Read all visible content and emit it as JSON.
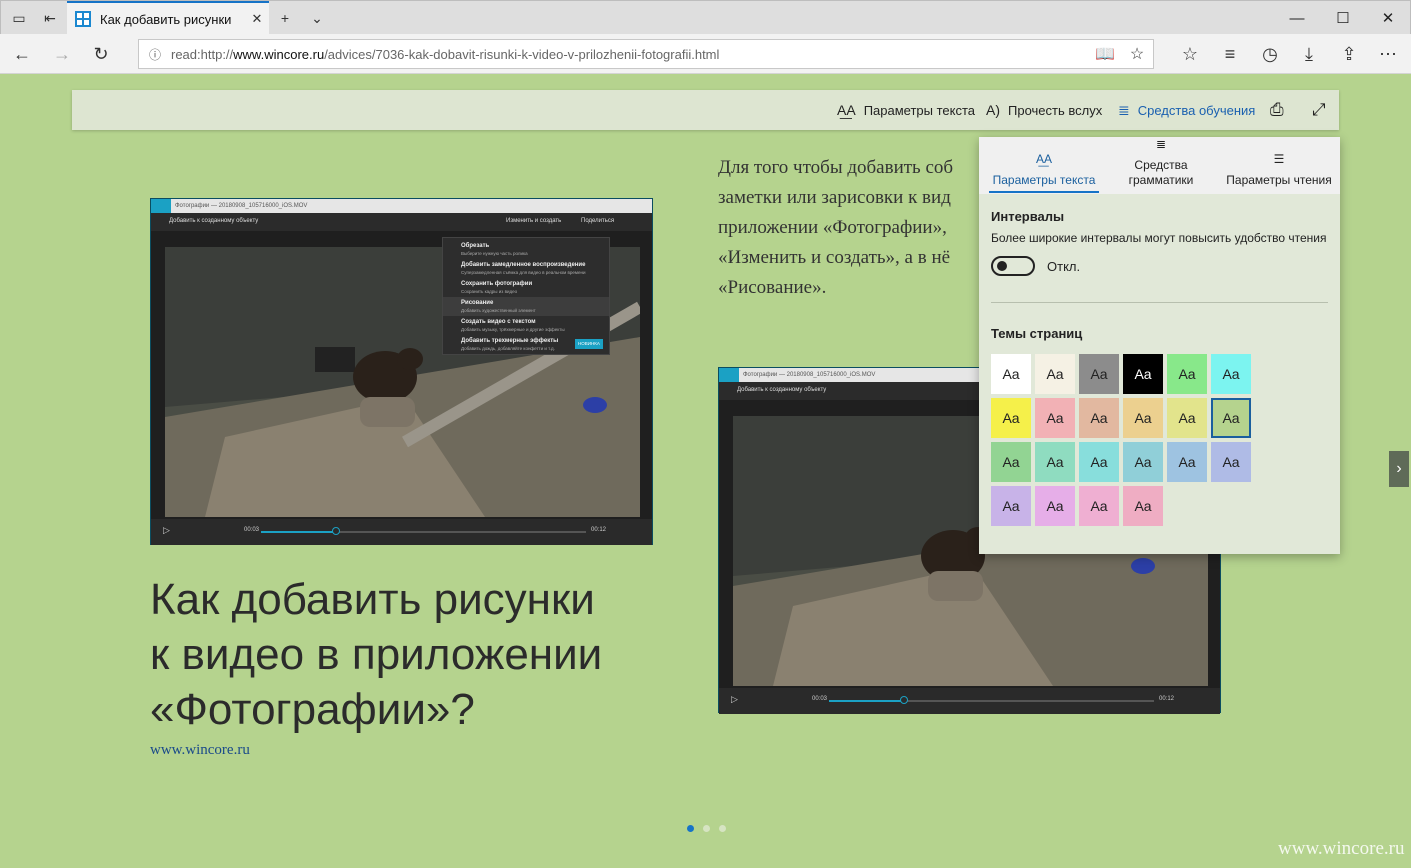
{
  "browser": {
    "tab_title": "Как добавить рисунки",
    "url_prefix": "read:http://",
    "url_host": "www.wincore.ru",
    "url_path": "/advices/7036-kak-dobavit-risunki-k-video-v-prilozhenii-fotografii.html"
  },
  "reader_toolbar": {
    "text_options": "Параметры текста",
    "read_aloud": "Прочесть вслух",
    "learning_tools": "Средства обучения"
  },
  "article": {
    "text_lines": [
      "Для того чтобы добавить соб",
      "заметки или зарисовки к вид",
      "приложении «Фотографии»,",
      "«Изменить и создать», а в нё",
      "«Рисование»."
    ],
    "headline_lines": [
      "Как добавить рисунки",
      "к видео в приложении",
      "«Фотографии»?"
    ],
    "site": "www.wincore.ru",
    "watermark": "www.wincore.ru"
  },
  "photos_window": {
    "title": "Фотографии — 20180908_105716000_iOS.MOV",
    "add_label": "Добавить к созданному объекту",
    "edit_create": "Изменить и создать",
    "share": "Поделиться",
    "time_start": "00:03",
    "time_end": "00:12",
    "menu": [
      {
        "title": "Обрезать",
        "sub": "Выберите нужную часть ролика"
      },
      {
        "title": "Добавить замедленное воспроизведение",
        "sub": "Суперзамедленная съёмка для видео в реальном времени"
      },
      {
        "title": "Сохранить фотографии",
        "sub": "Сохранить кадры из видео"
      },
      {
        "title": "Рисование",
        "sub": "Добавить художественный элемент"
      },
      {
        "title": "Создать видео с текстом",
        "sub": "Добавить музыку, трёхмерные и другие эффекты"
      },
      {
        "title": "Добавить трехмерные эффекты",
        "sub": "Добавить дождь, добавляйте конфетти и т.д.",
        "badge": "НОВИНКА"
      }
    ]
  },
  "panel": {
    "tabs": [
      "Параметры текста",
      "Средства\nграмматики",
      "Параметры чтения"
    ],
    "spacing_title": "Интервалы",
    "spacing_desc": "Более широкие интервалы могут повысить удобство чтения",
    "toggle_label": "Откл.",
    "themes_title": "Темы страниц",
    "swatch_label": "Aa",
    "themes": [
      [
        "#ffffff",
        "#f5f1e4",
        "#8c8c8c",
        "#000000",
        "#88e88a",
        "#7cf4f0"
      ],
      [
        "#f5f04a",
        "#f2b1b5",
        "#e2b8a0",
        "#ecd08f",
        "#e2e48c",
        "#b5d38e"
      ],
      [
        "#92d493",
        "#8fdcc0",
        "#88dedc",
        "#90cfd8",
        "#9ec3e1",
        "#afbbe6"
      ],
      [
        "#c8b3e8",
        "#e6aee8",
        "#efafd2",
        "#efadc3"
      ]
    ]
  }
}
